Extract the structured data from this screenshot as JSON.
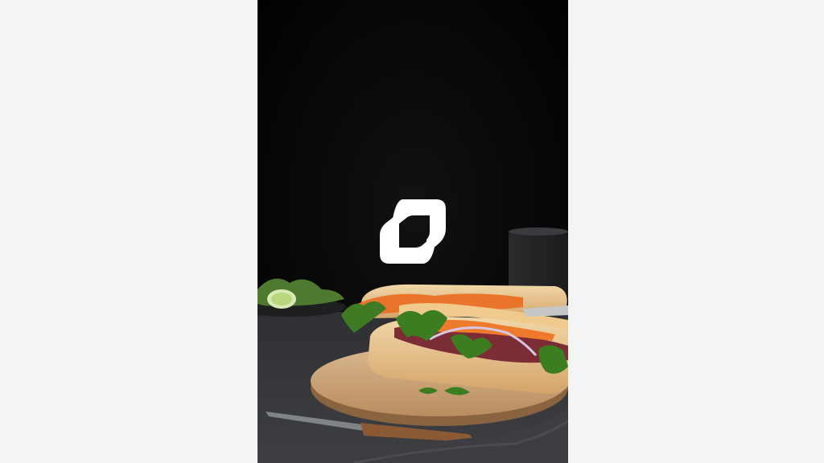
{
  "page": {
    "background_color": "#f4f4f4"
  },
  "photo": {
    "subject": "banh-mi-sandwich-photo",
    "background_color": "#000000"
  },
  "logo": {
    "icon": "brand-logo-icon",
    "color": "#ffffff"
  }
}
